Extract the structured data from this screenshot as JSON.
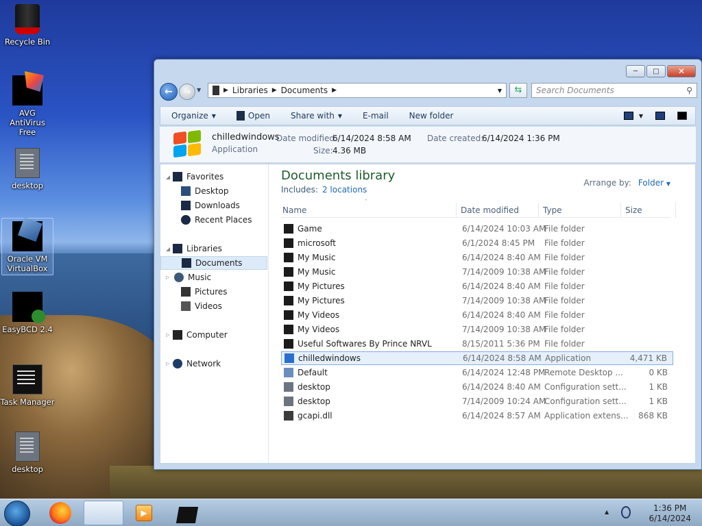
{
  "desktop": {
    "icons": [
      {
        "label": "Recycle Bin"
      },
      {
        "label": "AVG AntiVirus Free"
      },
      {
        "label": "desktop"
      },
      {
        "label": "Oracle VM VirtualBox"
      },
      {
        "label": "EasyBCD 2.4"
      },
      {
        "label": "Task Manager"
      },
      {
        "label": "desktop"
      }
    ]
  },
  "window": {
    "breadcrumb": [
      "Libraries",
      "Documents"
    ],
    "search_placeholder": "Search Documents",
    "toolbar": {
      "organize": "Organize",
      "open": "Open",
      "share_with": "Share with",
      "email": "E-mail",
      "new_folder": "New folder"
    },
    "details": {
      "name": "chilledwindows",
      "type": "Application",
      "date_modified_label": "Date modified:",
      "date_modified": "6/14/2024 8:58 AM",
      "size_label": "Size:",
      "size": "4.36 MB",
      "date_created_label": "Date created:",
      "date_created": "6/14/2024 1:36 PM"
    },
    "nav": {
      "favorites": "Favorites",
      "desktop": "Desktop",
      "downloads": "Downloads",
      "recent": "Recent Places",
      "libraries": "Libraries",
      "documents": "Documents",
      "music": "Music",
      "pictures": "Pictures",
      "videos": "Videos",
      "computer": "Computer",
      "network": "Network"
    },
    "library": {
      "title": "Documents library",
      "includes": "Includes:",
      "locations": "2 locations",
      "arrange_by": "Arrange by:",
      "arrange_value": "Folder"
    },
    "columns": {
      "name": "Name",
      "date": "Date modified",
      "type": "Type",
      "size": "Size"
    },
    "files": [
      {
        "name": "Game",
        "date": "6/14/2024 10:03 AM",
        "type": "File folder",
        "size": ""
      },
      {
        "name": "microsoft",
        "date": "6/1/2024 8:45 PM",
        "type": "File folder",
        "size": ""
      },
      {
        "name": "My Music",
        "date": "6/14/2024 8:40 AM",
        "type": "File folder",
        "size": ""
      },
      {
        "name": "My Music",
        "date": "7/14/2009 10:38 AM",
        "type": "File folder",
        "size": ""
      },
      {
        "name": "My Pictures",
        "date": "6/14/2024 8:40 AM",
        "type": "File folder",
        "size": ""
      },
      {
        "name": "My Pictures",
        "date": "7/14/2009 10:38 AM",
        "type": "File folder",
        "size": ""
      },
      {
        "name": "My Videos",
        "date": "6/14/2024 8:40 AM",
        "type": "File folder",
        "size": ""
      },
      {
        "name": "My Videos",
        "date": "7/14/2009 10:38 AM",
        "type": "File folder",
        "size": ""
      },
      {
        "name": "Useful Softwares By Prince NRVL",
        "date": "8/15/2011 5:36 PM",
        "type": "File folder",
        "size": ""
      },
      {
        "name": "chilledwindows",
        "date": "6/14/2024 8:58 AM",
        "type": "Application",
        "size": "4,471 KB"
      },
      {
        "name": "Default",
        "date": "6/14/2024 12:48 PM",
        "type": "Remote Desktop ...",
        "size": "0 KB"
      },
      {
        "name": "desktop",
        "date": "6/14/2024 8:40 AM",
        "type": "Configuration sett...",
        "size": "1 KB"
      },
      {
        "name": "desktop",
        "date": "7/14/2009 10:24 AM",
        "type": "Configuration sett...",
        "size": "1 KB"
      },
      {
        "name": "gcapi.dll",
        "date": "6/14/2024 8:57 AM",
        "type": "Application extens...",
        "size": "868 KB"
      }
    ]
  },
  "taskbar": {
    "time": "1:36 PM",
    "date": "6/14/2024"
  }
}
